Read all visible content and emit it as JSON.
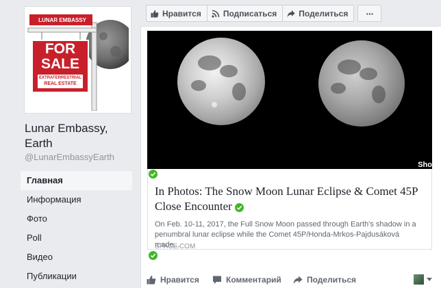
{
  "sidebar": {
    "page_name": "Lunar Embassy, Earth",
    "handle": "@LunarEmbassyEarth",
    "nav": [
      {
        "label": "Главная"
      },
      {
        "label": "Информация"
      },
      {
        "label": "Фото"
      },
      {
        "label": "Poll"
      },
      {
        "label": "Видео"
      },
      {
        "label": "Публикации"
      }
    ]
  },
  "profile_sign": {
    "top": "LUNAR EMBASSY",
    "line1": "FOR",
    "line2": "SALE",
    "line3": "EXTRATERRESTRIAL",
    "line4": "REAL ESTATE"
  },
  "action_bar": {
    "like": "Нравится",
    "subscribe": "Подписаться",
    "share": "Поделиться",
    "more": "···"
  },
  "post": {
    "title": "In Photos: The Snow Moon Lunar Eclipse & Comet 45P Close Encounter",
    "description": "On Feb. 10-11, 2017, the Full Snow Moon passed through Earth's shadow in a penumbral lunar eclipse while the Comet 45P/Honda-Mrkos-Pajdusáková made...",
    "domain": "SPACE.COM",
    "photo_watermark": "Sho"
  },
  "post_footer": {
    "like": "Нравится",
    "comment": "Комментарий",
    "share": "Поделиться"
  },
  "colors": {
    "page_bg": "#e9ebee",
    "sign_red": "#c8202b",
    "verified_green": "#42b72a"
  }
}
